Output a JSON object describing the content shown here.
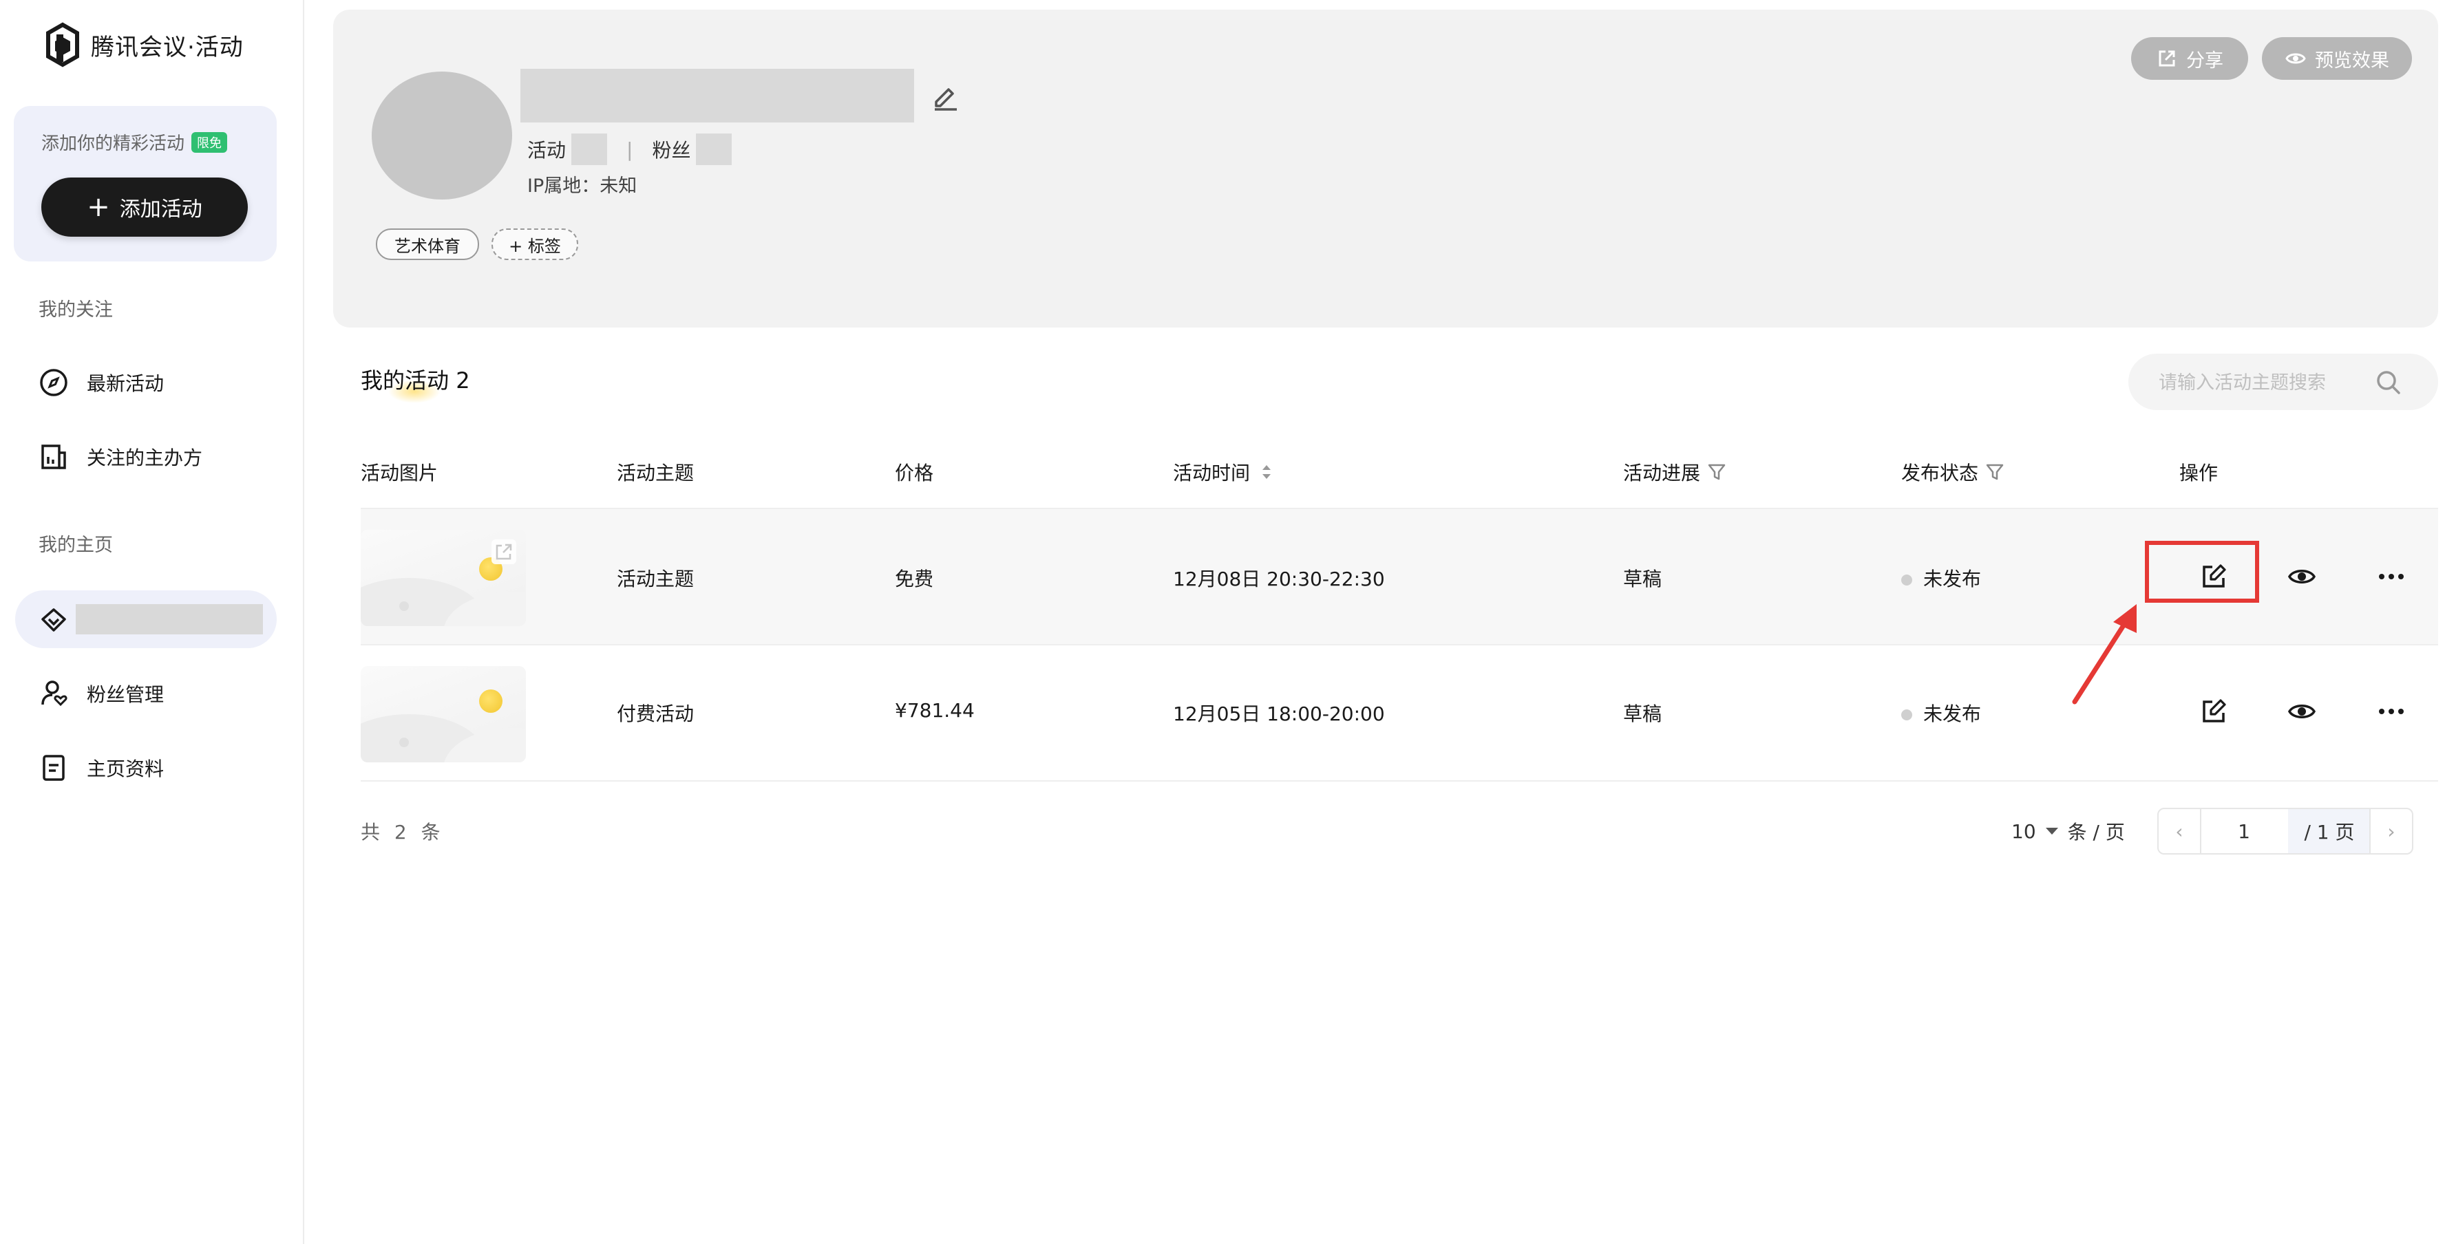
{
  "sidebar": {
    "brand": "腾讯会议·活动",
    "promo": {
      "title": "添加你的精彩活动",
      "badge": "限免",
      "add_button": "添加活动"
    },
    "section_follow": "我的关注",
    "follow_items": [
      {
        "label": "最新活动",
        "icon": "compass-icon"
      },
      {
        "label": "关注的主办方",
        "icon": "organizer-icon"
      }
    ],
    "section_home": "我的主页",
    "home_items": [
      {
        "label": "粉丝管理",
        "icon": "user-heart-icon"
      },
      {
        "label": "主页资料",
        "icon": "document-icon"
      }
    ]
  },
  "profile": {
    "stat_activity_label": "活动",
    "stat_fans_label": "粉丝",
    "ip_label": "IP属地：未知",
    "tags": [
      "艺术体育"
    ],
    "add_tag": "+ 标签",
    "share_button": "分享",
    "preview_button": "预览效果"
  },
  "activities": {
    "title": "我的活动",
    "count": "2",
    "search_placeholder": "请输入活动主题搜索",
    "columns": [
      "活动图片",
      "活动主题",
      "价格",
      "活动时间",
      "活动进展",
      "发布状态",
      "操作"
    ],
    "rows": [
      {
        "topic": "活动主题",
        "price": "免费",
        "time": "12月08日 20:30-22:30",
        "progress": "草稿",
        "status": "未发布"
      },
      {
        "topic": "付费活动",
        "price": "¥781.44",
        "time": "12月05日 18:00-20:00",
        "progress": "草稿",
        "status": "未发布"
      }
    ],
    "total": "共 2 条",
    "page_size": "10",
    "page_size_unit": "条 / 页",
    "current_page": "1",
    "page_total": "/ 1 页"
  },
  "colors": {
    "highlight": "#e53935",
    "accent_dark": "#1b1b1b",
    "badge_green": "#2fbf71"
  }
}
